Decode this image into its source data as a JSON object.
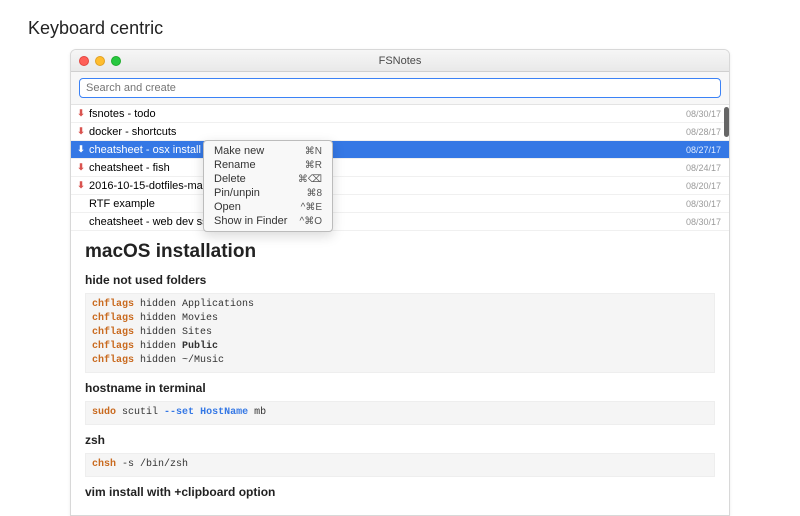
{
  "page_heading": "Keyboard centric",
  "window": {
    "title": "FSNotes",
    "search_placeholder": "Search and create"
  },
  "notes": [
    {
      "pinned": true,
      "title": "fsnotes - todo",
      "date": "08/30/17",
      "selected": false
    },
    {
      "pinned": true,
      "title": "docker - shortcuts",
      "date": "08/28/17",
      "selected": false
    },
    {
      "pinned": true,
      "title": "cheatsheet - osx install",
      "date": "08/27/17",
      "selected": true
    },
    {
      "pinned": true,
      "title": "cheatsheet - fish",
      "date": "08/24/17",
      "selected": false
    },
    {
      "pinned": true,
      "title": "2016-10-15-dotfiles-manager",
      "date": "08/20/17",
      "selected": false
    },
    {
      "pinned": false,
      "title": "RTF example",
      "date": "08/30/17",
      "selected": false
    },
    {
      "pinned": false,
      "title": "cheatsheet - web dev ssh tunnel",
      "date": "08/30/17",
      "selected": false
    }
  ],
  "context_menu": [
    {
      "label": "Make new",
      "shortcut": "⌘N"
    },
    {
      "label": "Rename",
      "shortcut": "⌘R"
    },
    {
      "label": "Delete",
      "shortcut": "⌘⌫"
    },
    {
      "label": "Pin/unpin",
      "shortcut": "⌘8"
    },
    {
      "label": "Open",
      "shortcut": "^⌘E"
    },
    {
      "label": "Show in Finder",
      "shortcut": "^⌘O"
    }
  ],
  "article": {
    "h1": "macOS installation",
    "sections": [
      {
        "heading": "hide not used folders",
        "code": "chflags hidden Applications\nchflags hidden Movies\nchflags hidden Sites\nchflags hidden Public\nchflags hidden ~/Music"
      },
      {
        "heading": "hostname in terminal",
        "code": "sudo scutil --set HostName mb"
      },
      {
        "heading": "zsh",
        "code": "chsh -s /bin/zsh"
      },
      {
        "heading": "vim install with +clipboard option",
        "code": ""
      }
    ]
  }
}
